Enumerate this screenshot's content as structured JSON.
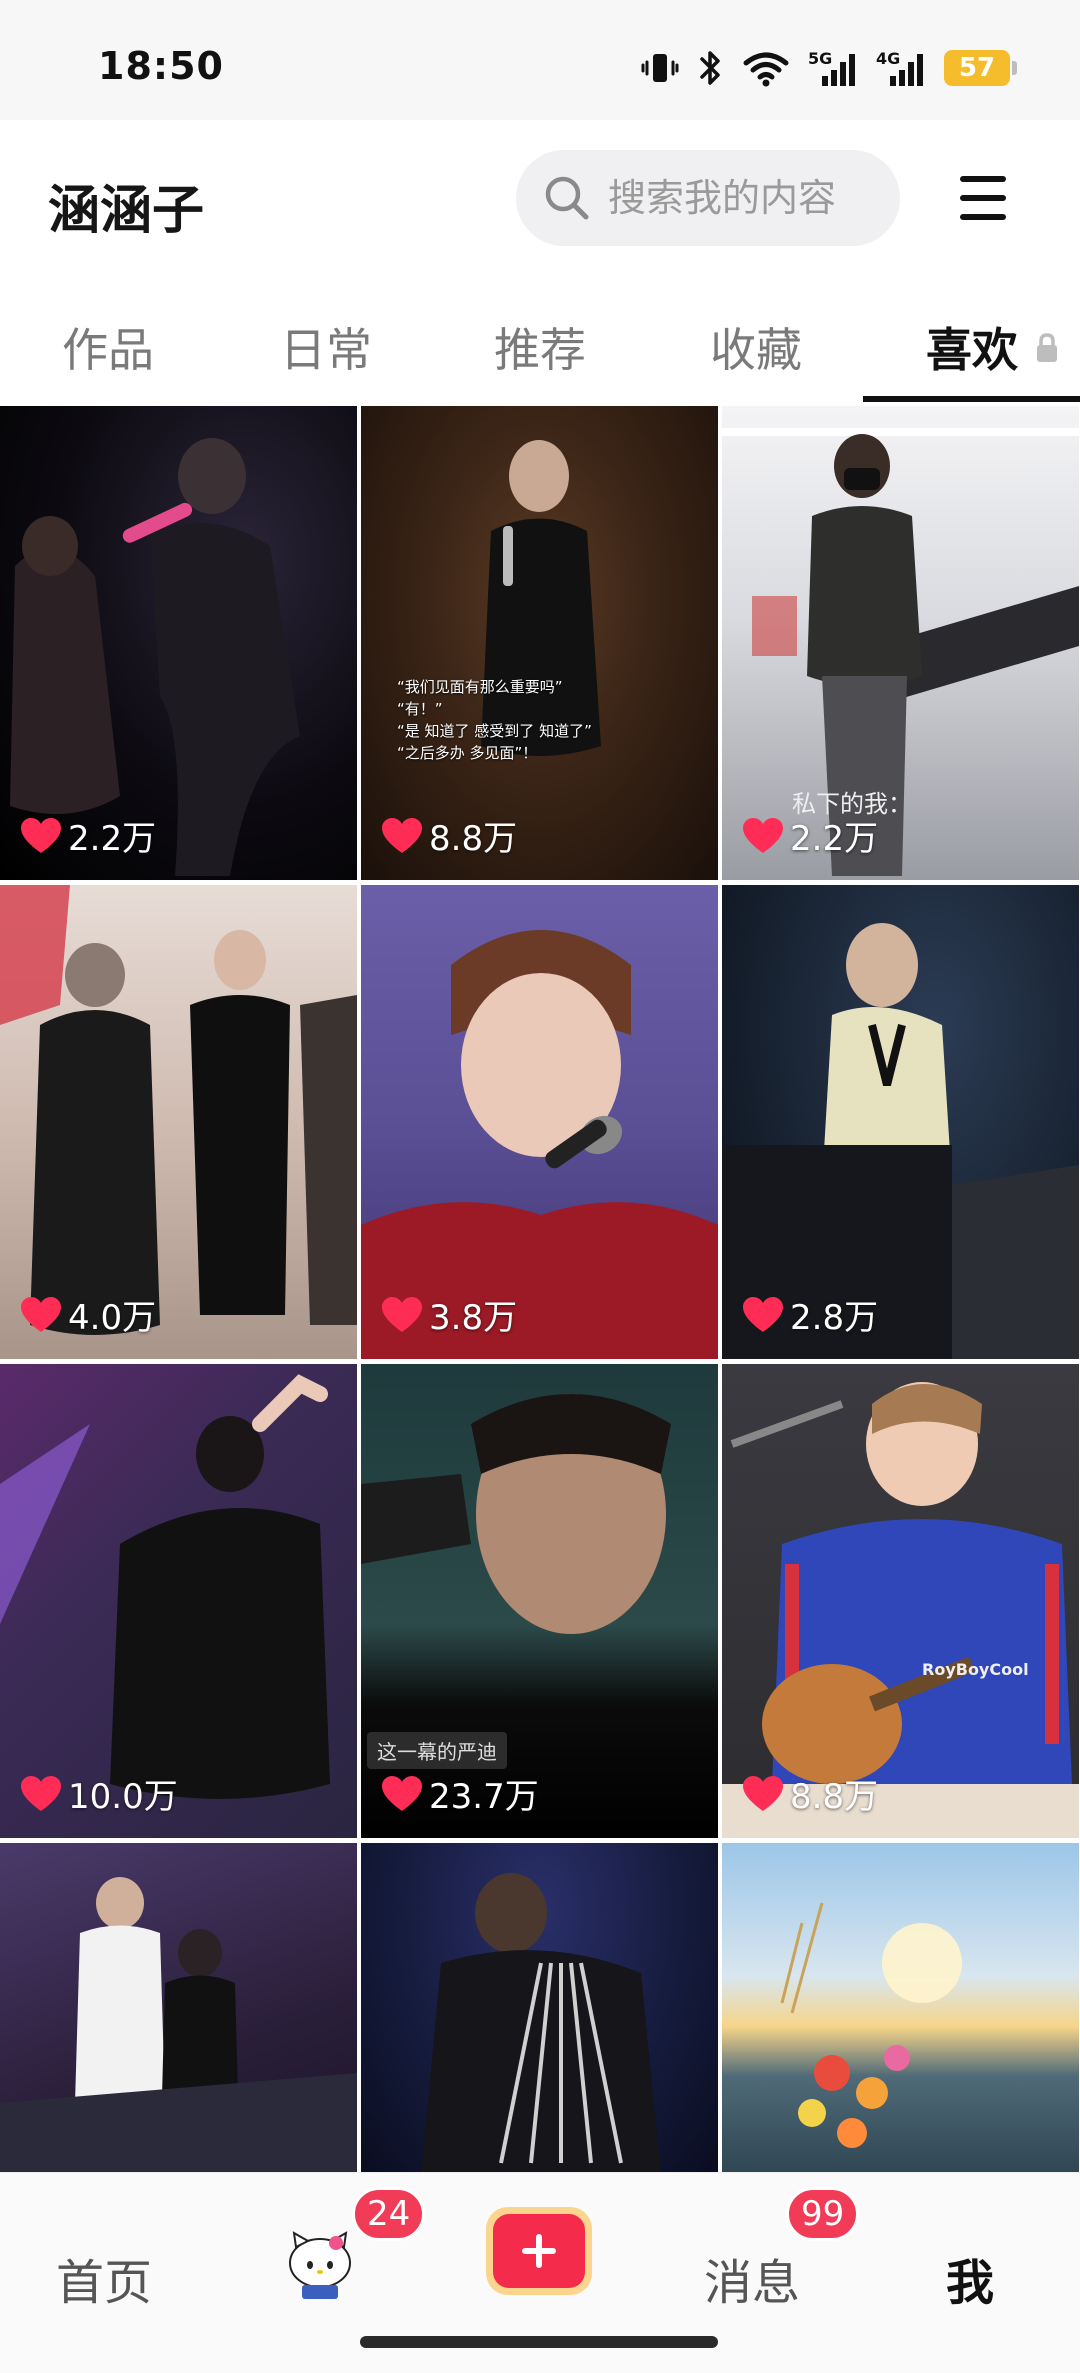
{
  "status_bar": {
    "time": "18:50",
    "icons": [
      "vibrate-icon",
      "bluetooth-icon",
      "wifi-icon",
      "5g-signal-icon",
      "4g-signal-icon"
    ],
    "signal_labels": {
      "first": "5G",
      "second": "4G"
    },
    "battery_level": "57"
  },
  "header": {
    "username": "涵涵子",
    "search_placeholder": "搜索我的内容",
    "menu_icon": "hamburger-menu-icon"
  },
  "tabs": [
    {
      "label": "作品",
      "active": false
    },
    {
      "label": "日常",
      "active": false
    },
    {
      "label": "推荐",
      "active": false
    },
    {
      "label": "收藏",
      "active": false
    },
    {
      "label": "喜欢",
      "active": true,
      "locked": true
    }
  ],
  "grid": {
    "items": [
      {
        "likes": "2.2万"
      },
      {
        "likes": "8.8万",
        "caption": [
          "“我们见面有那么重要吗”",
          "“有！”",
          "“是 知道了 感受到了 知道了”",
          "“之后多办 多见面”！"
        ]
      },
      {
        "likes": "2.2万",
        "overlay": "私下的我："
      },
      {
        "likes": "4.0万"
      },
      {
        "likes": "3.8万"
      },
      {
        "likes": "2.8万"
      },
      {
        "likes": "10.0万"
      },
      {
        "likes": "23.7万",
        "tag": "这一幕的严迪"
      },
      {
        "likes": "8.8万",
        "overlay": "RoyBoyCool"
      },
      {},
      {},
      {}
    ]
  },
  "bottom_nav": {
    "home": "首页",
    "friends_badge": "24",
    "create_icon": "plus-icon",
    "messages": "消息",
    "messages_badge": "99",
    "me": "我"
  },
  "colors": {
    "accent": "#f52b4c",
    "badge": "#f23b57",
    "heart": "#ff2d55",
    "battery": "#f5bd2c"
  }
}
